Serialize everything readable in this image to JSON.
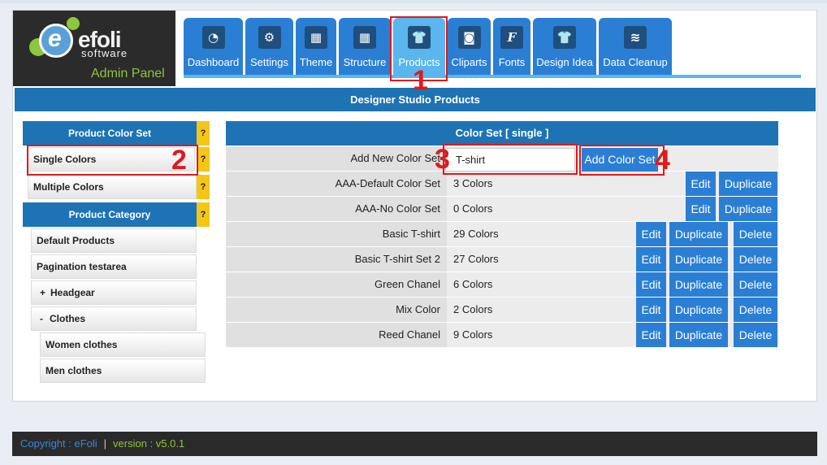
{
  "logo": {
    "brand": "efoli",
    "sub": "software",
    "panel": "Admin Panel",
    "icon": "efoli-logo"
  },
  "tabs": [
    {
      "label": "Dashboard",
      "icon": "dashboard-icon",
      "glyph": "◔"
    },
    {
      "label": "Settings",
      "icon": "gear-icon",
      "glyph": "⚙"
    },
    {
      "label": "Theme",
      "icon": "theme-icon",
      "glyph": "▦"
    },
    {
      "label": "Structure",
      "icon": "structure-icon",
      "glyph": "▦"
    },
    {
      "label": "Products",
      "icon": "tshirt-icon",
      "glyph": "👕",
      "active": true
    },
    {
      "label": "Cliparts",
      "icon": "camera-icon",
      "glyph": "◙"
    },
    {
      "label": "Fonts",
      "icon": "fonts-icon",
      "glyph": "F"
    },
    {
      "label": "Design Idea",
      "icon": "tshirt-icon",
      "glyph": "👕"
    },
    {
      "label": "Data Cleanup",
      "icon": "database-icon",
      "glyph": "≋"
    }
  ],
  "page_title": "Designer Studio Products",
  "sidebar": {
    "color_set_header": "Product Color Set",
    "help": "?",
    "single_colors": "Single Colors",
    "multiple_colors": "Multiple Colors",
    "category_header": "Product Category",
    "categories": [
      {
        "label": "Default Products"
      },
      {
        "label": "Pagination testarea"
      },
      {
        "label": "Headgear",
        "toggle": "+"
      },
      {
        "label": "Clothes",
        "toggle": "-"
      },
      {
        "label": "Women clothes"
      },
      {
        "label": "Men clothes"
      }
    ]
  },
  "table": {
    "header": "Color Set [ single ]",
    "add_label": "Add New Color Set",
    "input_value": "T-shirt",
    "add_button": "Add Color Set",
    "edit": "Edit",
    "duplicate": "Duplicate",
    "delete": "Delete",
    "rows": [
      {
        "name": "AAA-Default Color Set",
        "count": "3 Colors",
        "deletable": false
      },
      {
        "name": "AAA-No Color Set",
        "count": "0 Colors",
        "deletable": false
      },
      {
        "name": "Basic T-shirt",
        "count": "29 Colors",
        "deletable": true
      },
      {
        "name": "Basic T-shirt Set 2",
        "count": "27 Colors",
        "deletable": true
      },
      {
        "name": "Green Chanel",
        "count": "6 Colors",
        "deletable": true
      },
      {
        "name": "Mix Color",
        "count": "2 Colors",
        "deletable": true
      },
      {
        "name": "Reed Chanel",
        "count": "9 Colors",
        "deletable": true
      }
    ]
  },
  "annotations": [
    "1",
    "2",
    "3",
    "4"
  ],
  "footer": {
    "copyright": "Copyright : eFoli",
    "separator": "|",
    "version": "version : v5.0.1"
  }
}
